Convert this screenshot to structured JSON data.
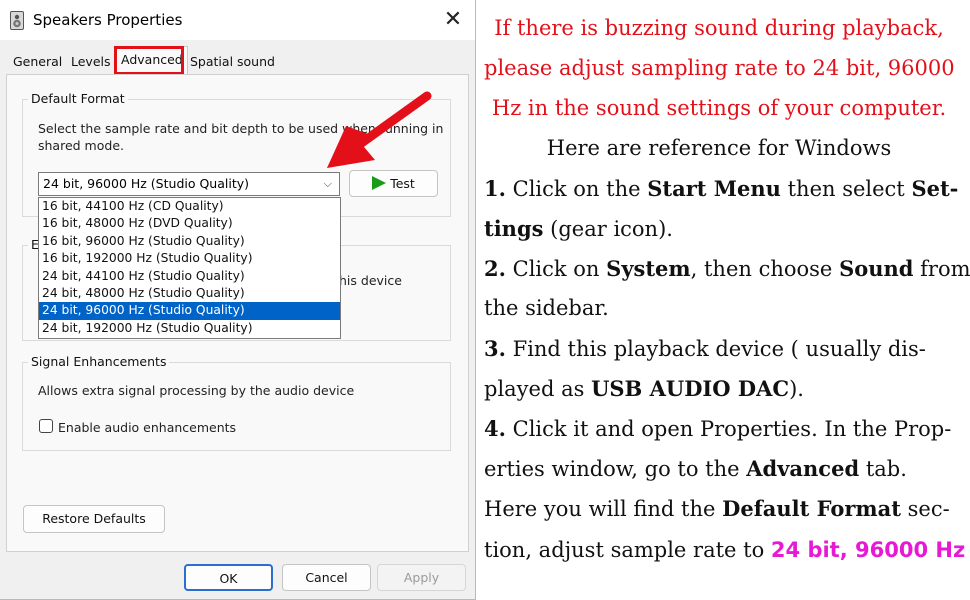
{
  "dialog": {
    "title": "Speakers Properties",
    "close_glyph": "✕",
    "tabs": [
      "General",
      "Levels",
      "Advanced",
      "Spatial sound"
    ],
    "default_format": {
      "title": "Default Format",
      "desc_1": "Select the sample rate and bit depth to be used when running in",
      "desc_2": "shared mode.",
      "selected": "24 bit, 96000 Hz (Studio Quality)",
      "test_label": "Test",
      "options": [
        "16 bit, 44100 Hz (CD Quality)",
        "16 bit, 48000 Hz (DVD Quality)",
        "16 bit, 96000 Hz (Studio Quality)",
        "16 bit, 192000 Hz (Studio Quality)",
        "24 bit, 44100 Hz (Studio Quality)",
        "24 bit, 48000 Hz (Studio Quality)",
        "24 bit, 96000 Hz (Studio Quality)",
        "24 bit, 192000 Hz (Studio Quality)"
      ]
    },
    "exclusive_partial": {
      "title_fragment": "E",
      "text_fragment": "his device"
    },
    "signal_enhancements": {
      "title": "Signal Enhancements",
      "desc": "Allows extra signal processing by the audio device",
      "checkbox_label": "Enable audio enhancements",
      "checked": false
    },
    "restore_label": "Restore Defaults",
    "ok_label": "OK",
    "cancel_label": "Cancel",
    "apply_label": "Apply"
  },
  "instructions": {
    "intro_1": "If there is buzzing sound during playback,",
    "intro_2": "please adjust sampling rate to 24 bit, 96000",
    "intro_3": "Hz in the sound settings of your computer.",
    "subtitle": "Here are reference for Windows",
    "step1": {
      "num": "1.",
      "a": "Click on the",
      "b": "Start Menu",
      "c": "then select",
      "d": "Set-",
      "e": "tings",
      "f": "(gear icon)."
    },
    "step2": {
      "num": "2.",
      "a": "Click on",
      "b": "System",
      "c": ", then choose",
      "d": "Sound",
      "e": "from",
      "f": "the sidebar."
    },
    "step3": {
      "num": "3.",
      "a": "Find this playback device ( usually dis-",
      "b": "played as",
      "c": "USB AUDIO DAC",
      "d": ")."
    },
    "step4": {
      "num": "4.",
      "a": "Click it and open Properties. In the Prop-",
      "b": "erties window, go to the",
      "c": "Advanced",
      "d": "tab.",
      "e": "Here you will find the",
      "f": "Default Format",
      "g": "sec-",
      "h": "tion,  adjust sample rate to",
      "i": "24 bit, 96000 Hz"
    }
  },
  "colors": {
    "red": "#e3101a",
    "highlight": "#e619d5",
    "selection": "#0063c7"
  }
}
